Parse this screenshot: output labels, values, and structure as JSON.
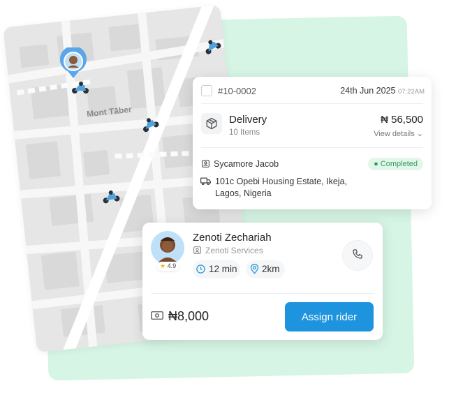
{
  "map": {
    "area_label": "Mont Tāber"
  },
  "order": {
    "id": "#10-0002",
    "date": "24th Jun 2025",
    "time": "07:22AM",
    "type": "Delivery",
    "items": "10 Items",
    "amount": "₦ 56,500",
    "view_details": "View details",
    "customer": "Sycamore Jacob",
    "status": "Completed",
    "address_line1": "101c Opebi Housing Estate, Ikeja,",
    "address_line2": "Lagos, Nigeria"
  },
  "rider": {
    "name": "Zenoti Zechariah",
    "company": "Zenoti Services",
    "rating": "4.9",
    "eta": "12 min",
    "distance": "2km",
    "fee": "₦8,000",
    "assign_label": "Assign rider"
  },
  "colors": {
    "accent": "#1f94de",
    "status_green": "#2f9a5a",
    "background_green": "#d6f5e4"
  }
}
